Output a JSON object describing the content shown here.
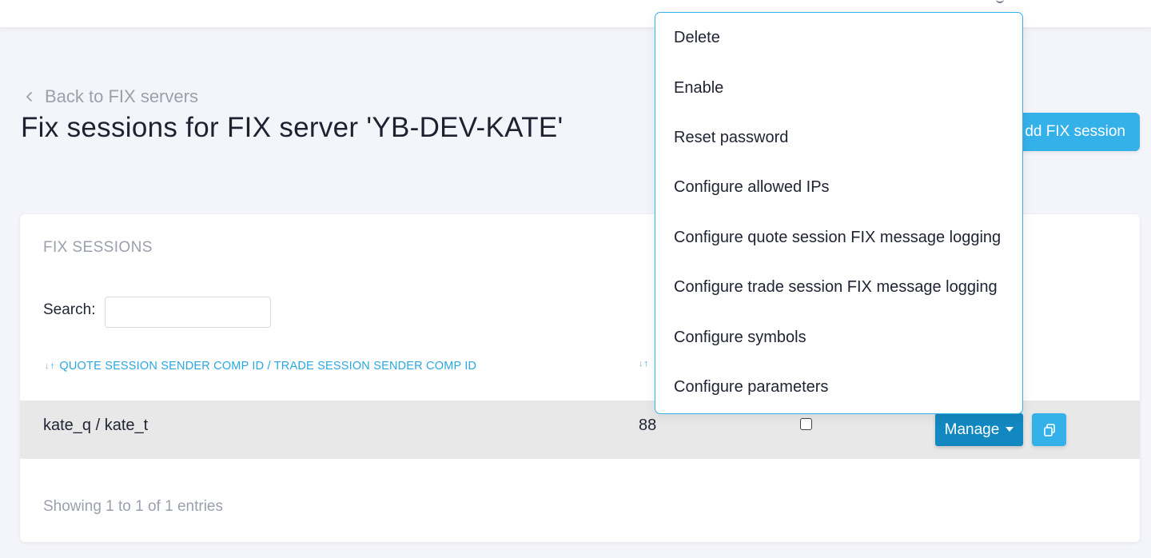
{
  "back_link": {
    "label": "Back to FIX servers"
  },
  "page_title": "Fix sessions for FIX server 'YB-DEV-KATE'",
  "add_button": {
    "label": "dd FIX session"
  },
  "card": {
    "title": "FIX SESSIONS",
    "search_label": "Search:",
    "search_value": "",
    "column_header": "QUOTE SESSION SENDER COMP ID / TRADE SESSION SENDER COMP ID",
    "rows": [
      {
        "id": "kate_q / kate_t",
        "number": "88",
        "checked": false,
        "manage_label": "Manage"
      }
    ],
    "footer": "Showing 1 to 1 of 1 entries"
  },
  "dropdown": {
    "items": [
      "Delete",
      "Enable",
      "Reset password",
      "Configure allowed IPs",
      "Configure quote session FIX message logging",
      "Configure trade session FIX message logging",
      "Configure symbols",
      "Configure parameters"
    ]
  },
  "colors": {
    "accent": "#35b1ea",
    "primary_button": "#1288c0",
    "link": "#2aa7e0",
    "muted_text": "#9aa0ac",
    "background": "#f4f5fa"
  }
}
